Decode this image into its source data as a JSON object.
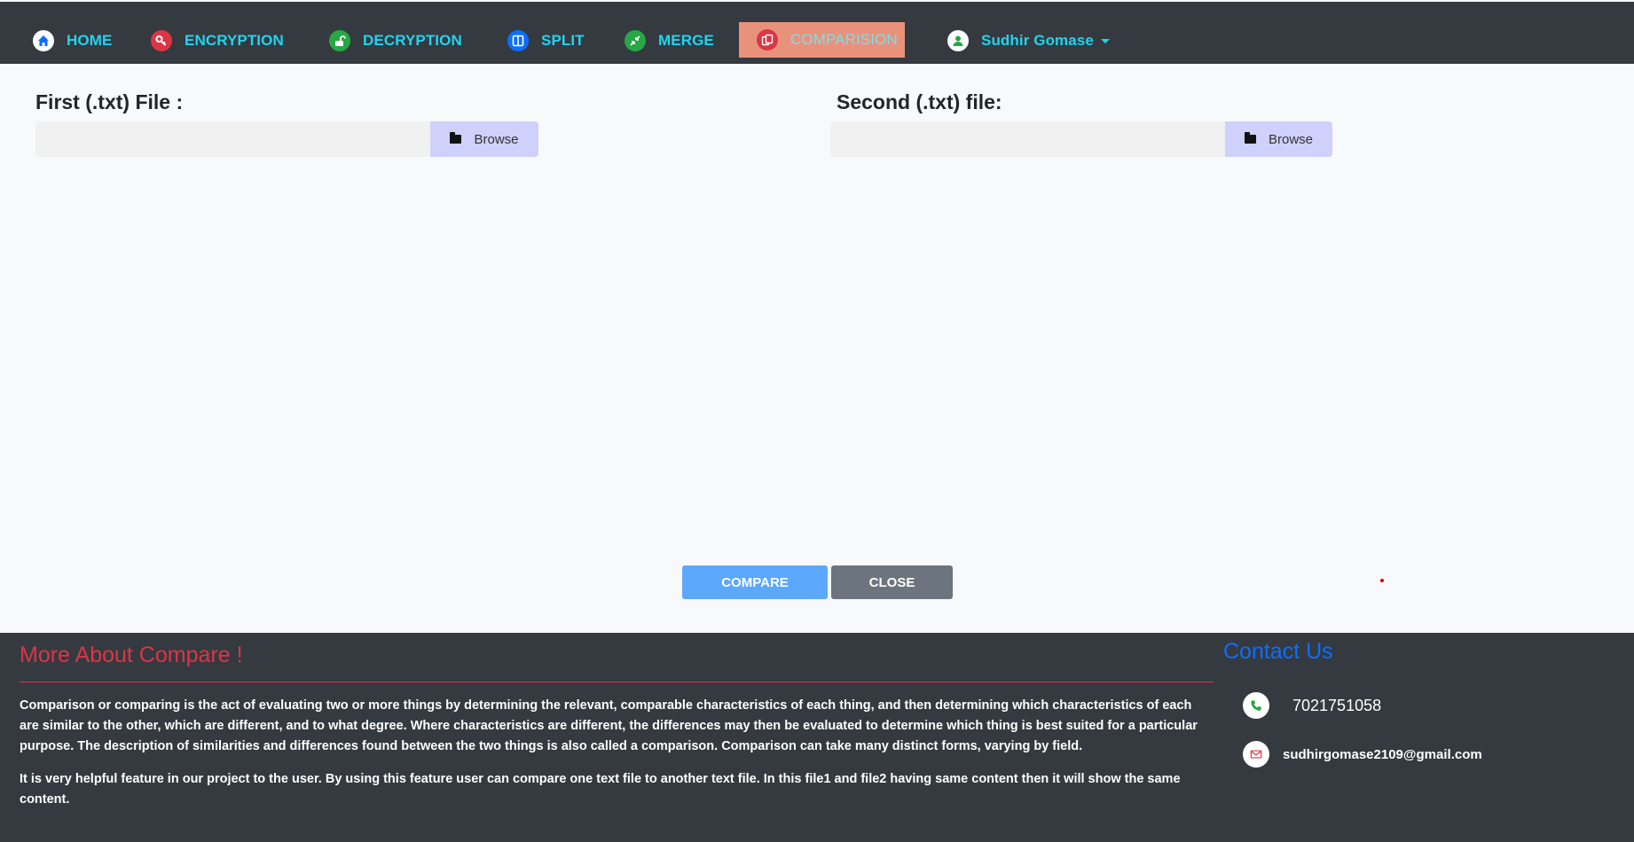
{
  "nav": {
    "items": [
      {
        "label": "HOME",
        "icon": "home-icon",
        "icon_color": "#0d6efd"
      },
      {
        "label": "ENCRYPTION",
        "icon": "key-icon",
        "icon_color": "#dc3545"
      },
      {
        "label": "DECRYPTION",
        "icon": "unlock-icon",
        "icon_color": "#28a745"
      },
      {
        "label": "SPLIT",
        "icon": "columns-icon",
        "icon_color": "#0d6efd"
      },
      {
        "label": "MERGE",
        "icon": "merge-icon",
        "icon_color": "#28a745"
      },
      {
        "label": "COMPARISION",
        "icon": "copy-icon",
        "icon_color": "#dc3545",
        "active": true
      }
    ],
    "user": {
      "name": "Sudhir Gomase",
      "icon": "user-icon"
    }
  },
  "main": {
    "first_label": "First (.txt) File :",
    "second_label": "Second (.txt) file:",
    "first_browse": "Browse",
    "second_browse": "Browse",
    "compare_btn": "COMPARE",
    "close_btn": "CLOSE"
  },
  "footer": {
    "about_title": "More About Compare !",
    "about_p1": "Comparison or comparing is the act of evaluating two or more things by determining the relevant, comparable characteristics of each thing, and then determining which characteristics of each are similar to the other, which are different, and to what degree. Where characteristics are different, the differences may then be evaluated to determine which thing is best suited for a particular purpose. The description of similarities and differences found between the two things is also called a comparison. Comparison can take many distinct forms, varying by field.",
    "about_p2": "It is very helpful feature in our project to the user. By using this feature user can compare one text file to another text file. In this file1 and file2 having same content then it will show the same content.",
    "contact_title": "Contact Us",
    "phone": "7021751058",
    "email": "sudhirgomase2109@gmail.com"
  },
  "colors": {
    "accent_text": "#22d3ee",
    "active_tab_bg": "#e8927c",
    "footer_title": "#dc3545",
    "contact_title": "#0d6efd"
  }
}
